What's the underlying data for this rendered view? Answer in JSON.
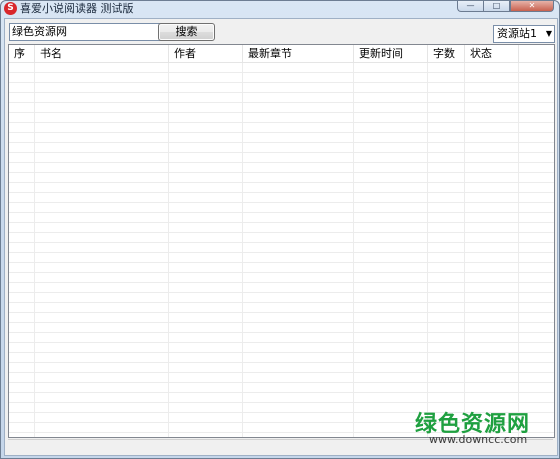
{
  "window": {
    "title": "喜爱小说阅读器 测试版"
  },
  "toolbar": {
    "search_value": "绿色资源网",
    "search_button": "搜索",
    "source_selected": "资源站1"
  },
  "table": {
    "columns": [
      "序",
      "书名",
      "作者",
      "最新章节",
      "更新时间",
      "字数",
      "状态"
    ]
  },
  "watermark": {
    "text": "绿色资源网",
    "url": "www.downcc.com"
  }
}
